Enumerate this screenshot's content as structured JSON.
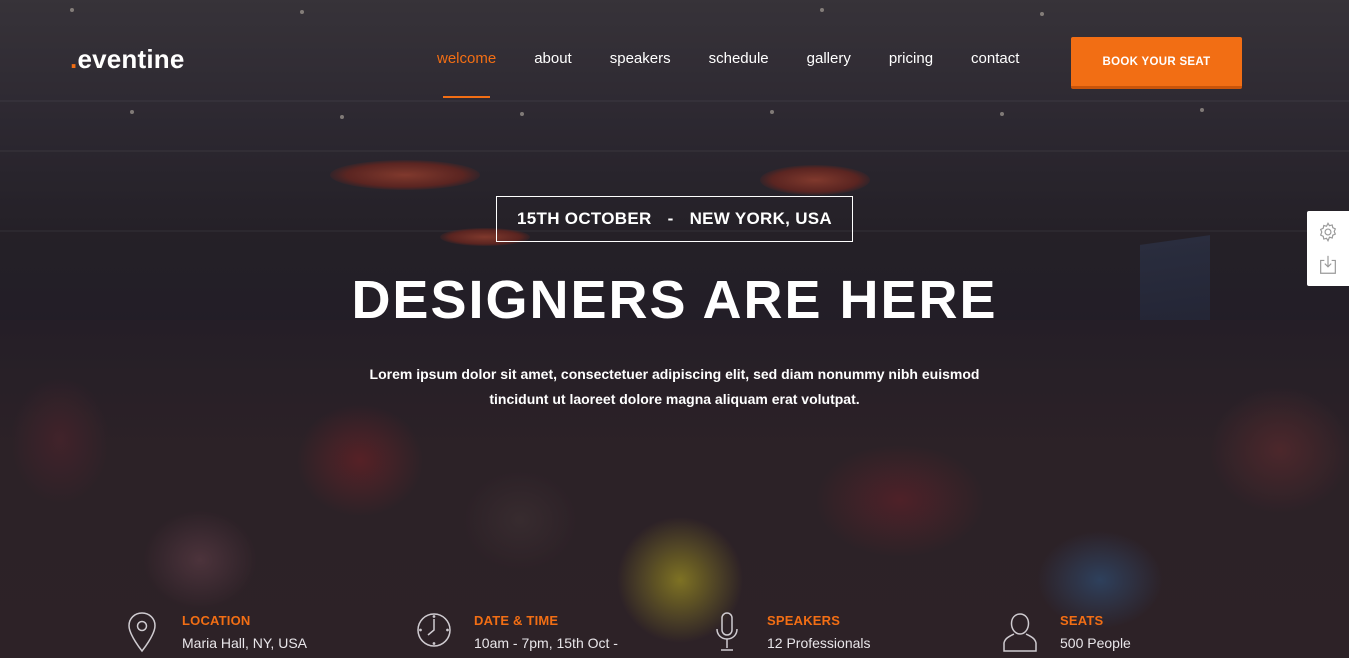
{
  "logo": {
    "dot": ".",
    "text": "eventine"
  },
  "nav": {
    "items": [
      {
        "label": "welcome",
        "active": true
      },
      {
        "label": "about",
        "active": false
      },
      {
        "label": "speakers",
        "active": false
      },
      {
        "label": "schedule",
        "active": false
      },
      {
        "label": "gallery",
        "active": false
      },
      {
        "label": "pricing",
        "active": false
      },
      {
        "label": "contact",
        "active": false
      }
    ],
    "cta_label": "BOOK YOUR SEAT"
  },
  "hero": {
    "date": "15TH OCTOBER",
    "separator": "-",
    "location": "NEW YORK, USA",
    "title": "DESIGNERS ARE HERE",
    "description_line1": "Lorem ipsum dolor sit amet, consectetuer adipiscing elit, sed diam nonummy nibh euismod",
    "description_line2": "tincidunt ut laoreet dolore magna aliquam erat volutpat."
  },
  "side_widget": {
    "icons": [
      "gear-icon",
      "download-icon"
    ]
  },
  "info": [
    {
      "icon": "location-pin-icon",
      "label": "LOCATION",
      "value": "Maria Hall, NY, USA"
    },
    {
      "icon": "clock-icon",
      "label": "DATE & TIME",
      "value": "10am - 7pm, 15th Oct -"
    },
    {
      "icon": "microphone-icon",
      "label": "SPEAKERS",
      "value": "12 Professionals"
    },
    {
      "icon": "user-icon",
      "label": "SEATS",
      "value": "500 People"
    }
  ],
  "colors": {
    "accent": "#f26e14",
    "text": "#ffffff"
  }
}
